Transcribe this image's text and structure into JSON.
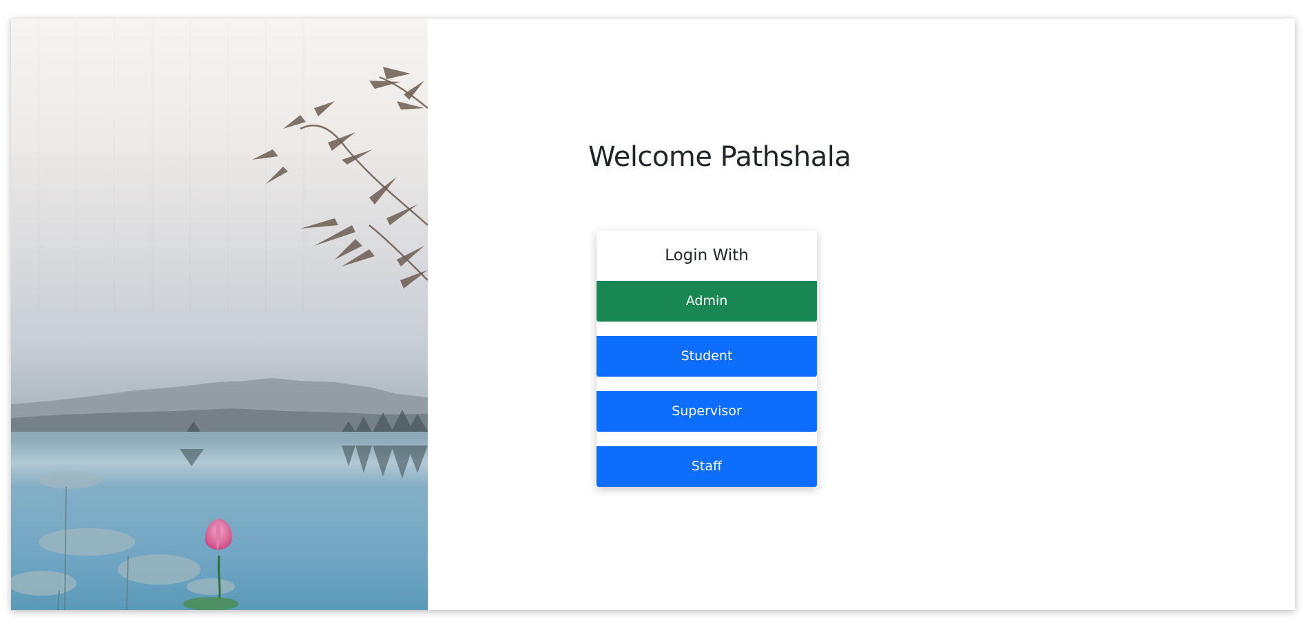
{
  "page": {
    "welcome_title": "Welcome Pathshala"
  },
  "login": {
    "heading": "Login With",
    "buttons": {
      "admin": "Admin",
      "student": "Student",
      "supervisor": "Supervisor",
      "staff": "Staff"
    }
  },
  "colors": {
    "admin_button": "#198754",
    "role_button": "#0d6efd",
    "text": "#212529"
  }
}
